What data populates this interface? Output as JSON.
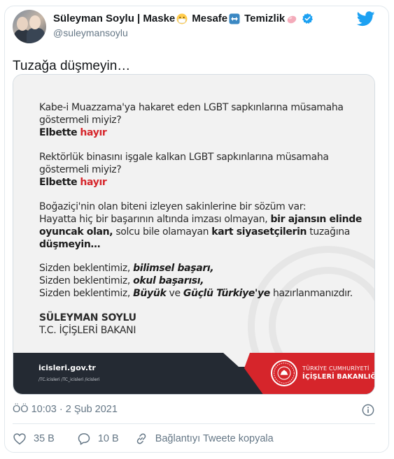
{
  "tweet": {
    "author_name": "Süleyman Soylu | Maske",
    "name_part2": "Mesafe",
    "name_part3": "Temizlik",
    "handle": "@suleymansoylu",
    "text": "Tuzağa düşmeyin…",
    "timestamp": "ÖÖ 10:03 · 2 Şub 2021",
    "likes": "35 B",
    "replies": "10 B",
    "share_label": "Bağlantıyı Tweete kopyala"
  },
  "poster": {
    "p1_line1": "Kabe-i Muazzama'ya hakaret eden LGBT sapkınlarına müsamaha",
    "p1_line2": "göstermeli miyiz?",
    "answer_a": "Elbette",
    "answer_b": "hayır",
    "p2_line1": "Rektörlük binasını işgale kalkan LGBT sapkınlarına müsamaha",
    "p2_line2": "göstermeli miyiz?",
    "p3_line1": "Boğaziçi'nin olan biteni izleyen sakinlerine bir sözüm var:",
    "p3_line2a": "Hayatta hiç bir başarının altında imzası olmayan,",
    "p3_line2b": "bir ajansın elinde",
    "p3_line3a": "oyuncak olan,",
    "p3_line3b": "solcu bile olamayan",
    "p3_line3c": "kart siyasetçilerin",
    "p3_line3d": "tuzağına",
    "p3_line4": "düşmeyin…",
    "p4_prefix": "Sizden beklentimiz,",
    "p4_line1_bold": "bilimsel başarı,",
    "p4_line2_bold": "okul başarısı,",
    "p4_line3_b1": "Büyük",
    "p4_line3_ve": "ve",
    "p4_line3_b2": "Güçlü Türkiye'ye",
    "p4_line3_end": "hazırlanmanızdır.",
    "signature_name": "SÜLEYMAN SOYLU",
    "signature_title": "T.C. İÇİŞLERİ BAKANI",
    "website": "icisleri.gov.tr",
    "socials": "/TC.icisleri   /TC_icisleri   /icisleri",
    "ministry_line1": "TÜRKİYE CUMHURİYETİ",
    "ministry_line2": "İÇİŞLERİ BAKANLIĞI"
  },
  "colors": {
    "twitter_blue": "#1da1f2",
    "accent_red": "#d6252b",
    "footer_dark": "#242a33",
    "muted_text": "#657786"
  },
  "icons": [
    "mask-emoji-icon",
    "left-right-arrow-emoji-icon",
    "soap-emoji-icon",
    "verified-badge-icon",
    "twitter-bird-icon",
    "info-icon",
    "heart-icon",
    "reply-icon",
    "link-icon",
    "ministry-emblem-icon"
  ]
}
